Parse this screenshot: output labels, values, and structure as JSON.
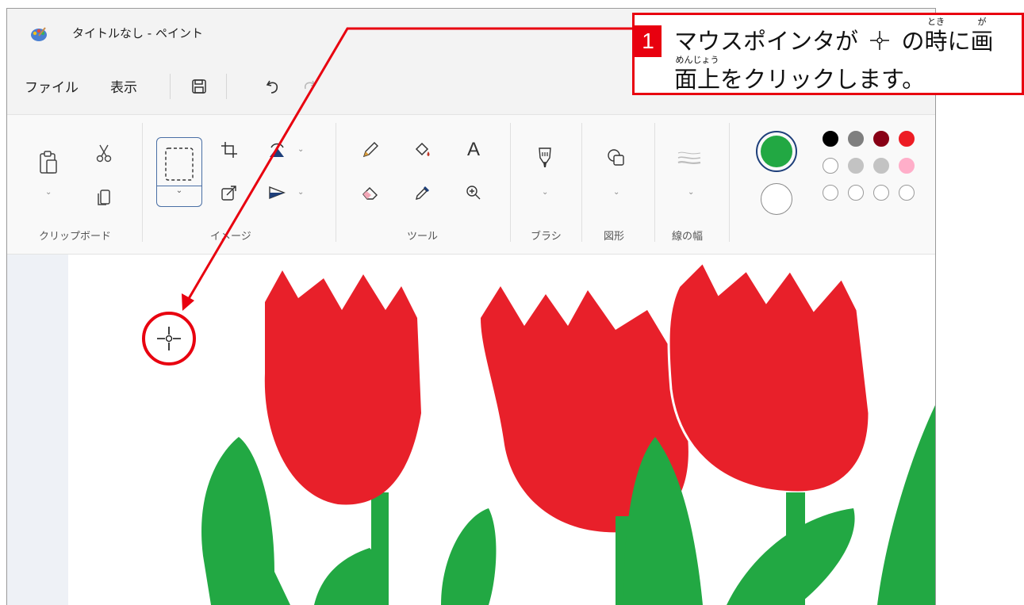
{
  "window": {
    "title": "タイトルなし - ペイント"
  },
  "menu": {
    "file": "ファイル",
    "view": "表示"
  },
  "ribbon": {
    "groups": {
      "clipboard": "クリップボード",
      "image": "イメージ",
      "tools": "ツール",
      "brushes": "ブラシ",
      "shapes": "図形",
      "size": "線の幅"
    },
    "text_tool_glyph": "A"
  },
  "colors": {
    "color1": "#22a843",
    "color2": "#ffffff",
    "palette_row1": [
      "#000000",
      "#7f7f7f",
      "#880015",
      "#ed1c24"
    ],
    "palette_row2": [
      "#ffffff",
      "#c3c3c3",
      "#c3c3c3",
      "#ffaec9"
    ],
    "palette_row3": [
      "#ffffff",
      "#ffffff",
      "#ffffff",
      "#ffffff"
    ],
    "accent_red": "#e8000f"
  },
  "callout": {
    "number": "1",
    "line1_a": "マウスポインタが",
    "line1_b": "の",
    "line1_kanji1": "時",
    "line1_ruby1": "とき",
    "line1_c": "に",
    "line1_kanji2": "画",
    "line1_ruby2": "が",
    "line2_kanji": "面上",
    "line2_ruby": "めんじょう",
    "line2_rest": "をクリックします。"
  },
  "icons": [
    "paint-app-icon",
    "save-icon",
    "undo-icon",
    "redo-icon",
    "paste-icon",
    "cut-icon",
    "copy-icon",
    "select-icon",
    "crop-icon",
    "rotate-icon",
    "resize-icon",
    "flip-icon",
    "pencil-icon",
    "fill-icon",
    "text-icon",
    "eraser-icon",
    "color-picker-icon",
    "magnifier-icon",
    "brush-icon",
    "shapes-icon",
    "line-width-icon",
    "crosshair-cursor-icon"
  ]
}
